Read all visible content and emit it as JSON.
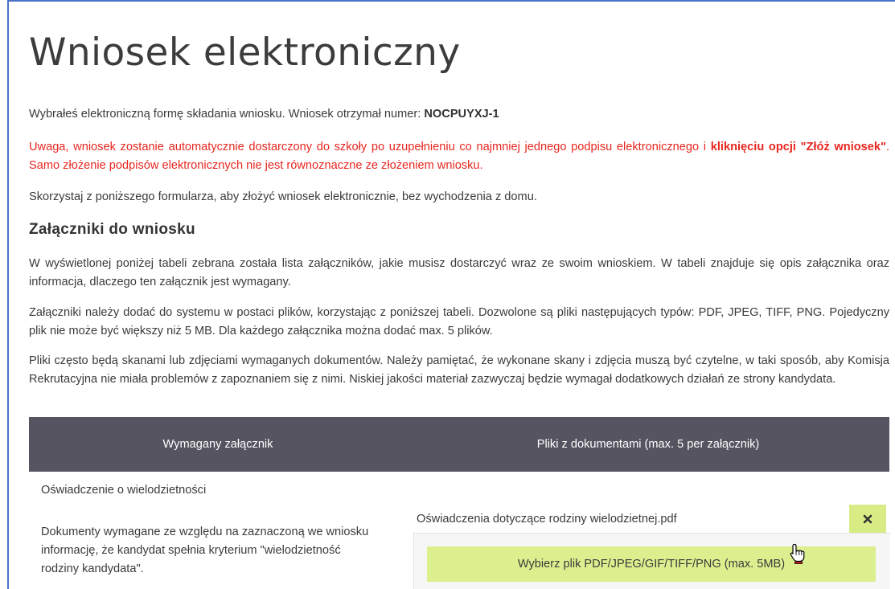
{
  "page": {
    "title": "Wniosek elektroniczny"
  },
  "intro": {
    "text": "Wybrałeś elektroniczną formę składania wniosku. Wniosek otrzymał numer: ",
    "number": "NOCPUYXJ-1"
  },
  "warning": {
    "text_a": "Uwaga, wniosek zostanie automatycznie dostarczony do szkoły po uzupełnieniu co najmniej jednego podpisu elektronicznego i ",
    "bold": "kliknięciu opcji \"Złóż wniosek\"",
    "text_b": ". Samo złożenie podpisów elektronicznych nie jest równoznaczne ze złożeniem wniosku."
  },
  "form_hint": "Skorzystaj z poniższego formularza, aby złożyć wniosek elektronicznie, bez wychodzenia z domu.",
  "attachments": {
    "heading": "Załączniki do wniosku",
    "para1": "W wyświetlonej poniżej tabeli zebrana została lista załączników, jakie musisz dostarczyć wraz ze swoim wnioskiem. W tabeli znajduje się opis załącznika oraz informacja, dlaczego ten załącznik jest wymagany.",
    "para2": "Załączniki należy dodać do systemu w postaci plików, korzystając z poniższej tabeli. Dozwolone są pliki następujących typów: PDF, JPEG, TIFF, PNG. Pojedyczny plik nie może być większy niż 5 MB. Dla każdego załącznika można dodać max. 5 plików.",
    "para3": "Pliki często będą skanami lub zdjęciami wymaganych dokumentów. Należy pamiętać, że wykonane skany i zdjęcia muszą być czytelne, w taki sposób, aby Komisja Rekrutacyjna nie miała problemów z zapoznaniem się z nimi. Niskiej jakości materiał zazwyczaj będzie wymagał dodatkowych działań ze strony kandydata."
  },
  "table": {
    "headers": [
      "Wymagany załącznik",
      "Pliki z dokumentami (max. 5 per załącznik)"
    ],
    "rows": [
      {
        "title": "Oświadczenie o wielodzietności",
        "description": "Dokumenty wymagane ze względu na zaznaczoną we wniosku informację, że kandydat spełnia kryterium \"wielodzietność rodziny kandydata\".",
        "file_name": "Oświadczenia dotyczące rodziny wielodzietnej.pdf",
        "remove_icon": "close-icon",
        "upload_label": "Wybierz plik PDF/JPEG/GIF/TIFF/PNG (max. 5MB)"
      }
    ]
  },
  "colors": {
    "header_bg": "#555460",
    "warning": "#e8261f",
    "button_bg": "#dbef8e",
    "frame": "#4a73c8"
  }
}
